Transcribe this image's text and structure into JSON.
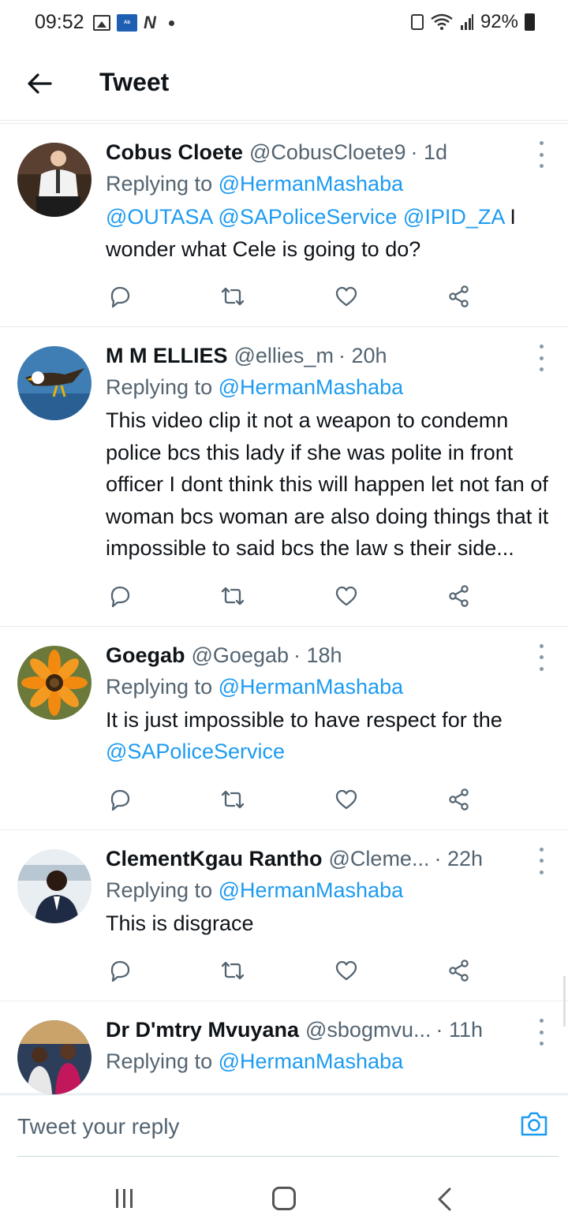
{
  "status_bar": {
    "time": "09:52",
    "app_icon_text": "Ab",
    "n_icon": "N",
    "battery": "92%"
  },
  "header": {
    "title": "Tweet"
  },
  "tweets": [
    {
      "name": "Cobus Cloete",
      "handle": "@CobusCloete9",
      "time": "· 1d",
      "replying_prefix": "Replying to ",
      "replying_to": "@HermanMashaba",
      "mention_line": "@OUTASA @SAPoliceService @IPID_ZA",
      "text_after": " I wonder what Cele is going to do?"
    },
    {
      "name": "M M ELLIES",
      "handle": "@ellies_m",
      "time": "· 20h",
      "replying_prefix": "Replying to ",
      "replying_to": "@HermanMashaba",
      "text": "This video clip it not a weapon to condemn  police bcs this lady if she was polite in front officer I dont think this will happen let not fan of woman bcs woman are also doing things that it impossible to said bcs the law s their side..."
    },
    {
      "name": "Goegab",
      "handle": "@Goegab",
      "time": "· 18h",
      "replying_prefix": "Replying to ",
      "replying_to": "@HermanMashaba",
      "text_before": "It is just impossible to have respect for the ",
      "mention": "@SAPoliceService"
    },
    {
      "name": "ClementKgau Rantho",
      "handle": "@Cleme...",
      "time": "· 22h",
      "replying_prefix": "Replying to ",
      "replying_to": "@HermanMashaba",
      "text": "This is disgrace"
    },
    {
      "name": "Dr D'mtry Mvuyana",
      "handle": "@sbogmvu...",
      "time": "· 11h",
      "replying_prefix": "Replying to ",
      "replying_to": "@HermanMashaba"
    }
  ],
  "reply_bar": {
    "placeholder": "Tweet your reply"
  },
  "icons": {
    "reply": "reply-icon",
    "retweet": "retweet-icon",
    "like": "like-icon",
    "share": "share-icon",
    "camera": "camera-icon",
    "back": "back-arrow-icon"
  },
  "colors": {
    "accent": "#1d9bf0",
    "secondary_text": "#536471",
    "primary_text": "#0f1419"
  }
}
